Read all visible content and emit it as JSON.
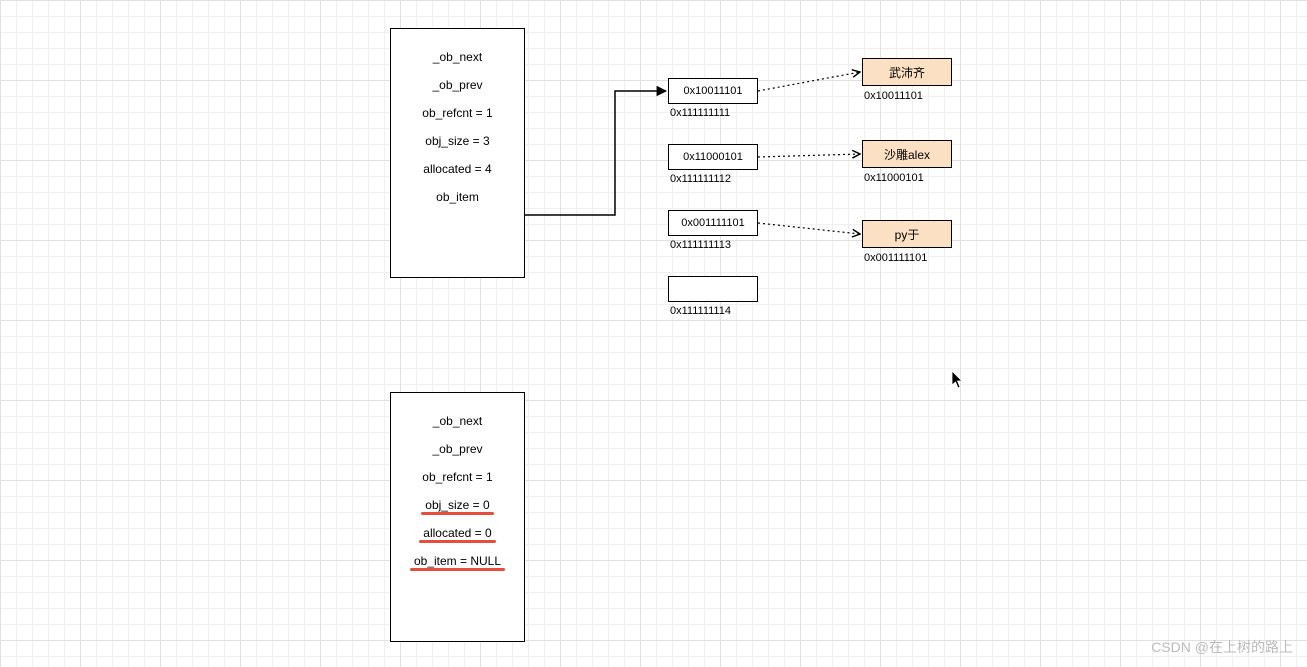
{
  "struct1": {
    "fields": [
      {
        "text": "_ob_next",
        "underline": false
      },
      {
        "text": "_ob_prev",
        "underline": false
      },
      {
        "text": "ob_refcnt = 1",
        "underline": false
      },
      {
        "text": "obj_size = 3",
        "underline": false
      },
      {
        "text": "allocated = 4",
        "underline": false
      },
      {
        "text": "ob_item",
        "underline": false
      }
    ]
  },
  "struct2": {
    "fields": [
      {
        "text": "_ob_next",
        "underline": false
      },
      {
        "text": "_ob_prev",
        "underline": false
      },
      {
        "text": "ob_refcnt = 1",
        "underline": false
      },
      {
        "text": "obj_size = 0",
        "underline": true
      },
      {
        "text": "allocated = 0",
        "underline": true
      },
      {
        "text": "ob_item = NULL",
        "underline": true
      }
    ]
  },
  "cells": [
    {
      "value": "0x10011101",
      "addr": "0x111111111"
    },
    {
      "value": "0x11000101",
      "addr": "0x111111112"
    },
    {
      "value": "0x001111101",
      "addr": "0x111111113"
    },
    {
      "value": "",
      "addr": "0x111111114"
    }
  ],
  "values": [
    {
      "label": "武沛齐",
      "addr": "0x10011101"
    },
    {
      "label": "沙雕alex",
      "addr": "0x11000101"
    },
    {
      "label": "py于",
      "addr": "0x001111101"
    }
  ],
  "watermark": "CSDN @在上树的路上"
}
